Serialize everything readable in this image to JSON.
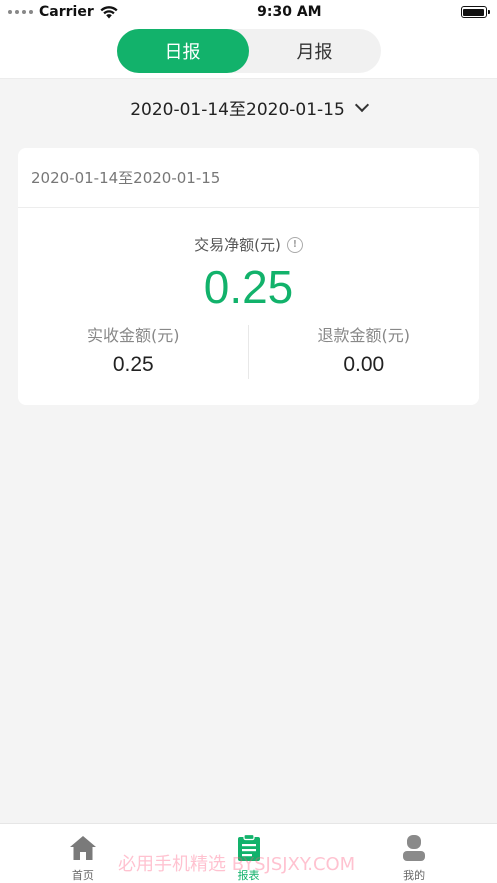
{
  "status_bar": {
    "carrier": "Carrier",
    "time": "9:30 AM"
  },
  "header": {
    "tabs": [
      {
        "label": "日报",
        "active": true
      },
      {
        "label": "月报",
        "active": false
      }
    ]
  },
  "date_selector": {
    "range": "2020-01-14至2020-01-15"
  },
  "card": {
    "header_range": "2020-01-14至2020-01-15",
    "net_label": "交易净额(元)",
    "net_value": "0.25",
    "received_label": "实收金额(元)",
    "received_value": "0.25",
    "refund_label": "退款金额(元)",
    "refund_value": "0.00"
  },
  "tab_bar": {
    "items": [
      {
        "label": "首页",
        "icon": "home-icon",
        "active": false
      },
      {
        "label": "报表",
        "icon": "report-icon",
        "active": true
      },
      {
        "label": "我的",
        "icon": "profile-icon",
        "active": false
      }
    ]
  },
  "watermark": "必用手机精选 BYSJSJXY.COM",
  "colors": {
    "accent": "#12b26b",
    "background": "#f4f4f4"
  }
}
